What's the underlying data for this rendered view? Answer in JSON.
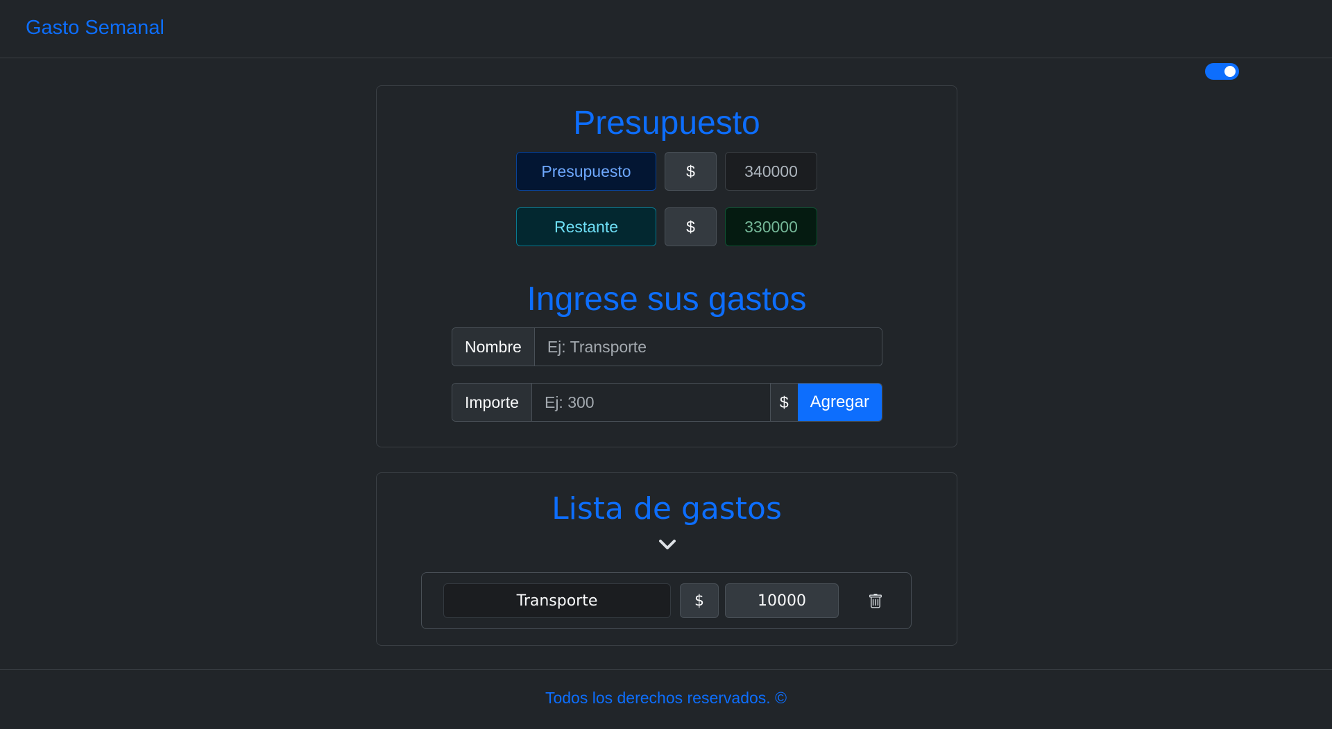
{
  "navbar": {
    "brand": "Gasto Semanal"
  },
  "theme_toggle": {
    "checked": true,
    "accent": "#0d6efd"
  },
  "budget": {
    "title": "Presupuesto",
    "presupuesto_label": "Presupuesto",
    "presupuesto_currency": "$",
    "presupuesto_value": "340000",
    "restante_label": "Restante",
    "restante_currency": "$",
    "restante_value": "330000"
  },
  "form": {
    "title": "Ingrese sus gastos",
    "name_label": "Nombre",
    "name_placeholder": "Ej: Transporte",
    "amount_label": "Importe",
    "amount_placeholder": "Ej: 300",
    "amount_currency": "$",
    "add_button": "Agregar"
  },
  "expenses": {
    "title": "Lista de gastos",
    "toggle_icon": "chevron-down-icon",
    "items": [
      {
        "name": "Transporte",
        "currency": "$",
        "amount": "10000",
        "delete_icon": "trash-icon"
      }
    ]
  },
  "footer": {
    "text": "Todos los derechos reservados. ©"
  }
}
